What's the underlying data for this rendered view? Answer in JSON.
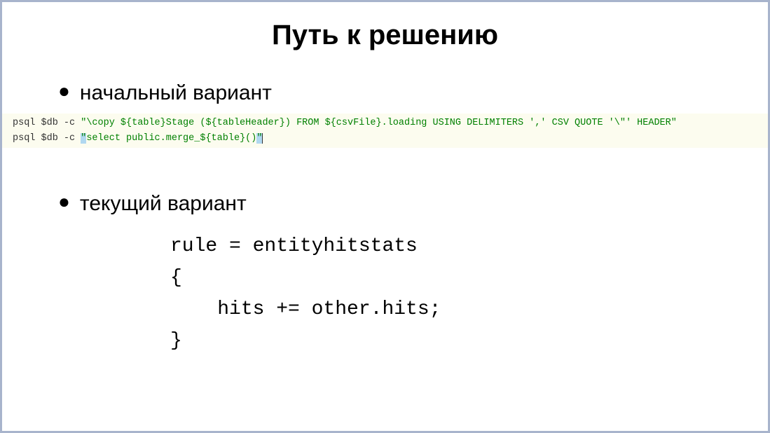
{
  "title": "Путь к решению",
  "bullets": {
    "first": "начальный вариант",
    "second": "текущий вариант"
  },
  "psql_code": {
    "line1_prefix": "psql $db -c ",
    "line1_string": "\"\\copy ${table}Stage (${tableHeader}) FROM ${csvFile}.loading USING DELIMITERS ',' CSV QUOTE '\\\"' HEADER\"",
    "line2_prefix": "psql $db -c ",
    "line2_quote_start": "\"",
    "line2_content": "select public.merge_${table}()",
    "line2_quote_end": "\""
  },
  "rule_code": {
    "line1": "rule = entityhitstats",
    "line2": "{",
    "line3": "    hits += other.hits;",
    "line4": "}"
  }
}
